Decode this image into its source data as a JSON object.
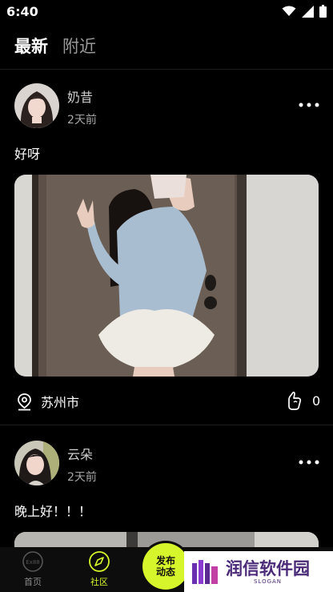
{
  "status_bar": {
    "time": "6:40"
  },
  "tabs": [
    {
      "label": "最新",
      "active": true
    },
    {
      "label": "附近",
      "active": false
    }
  ],
  "posts": [
    {
      "username": "奶昔",
      "time": "2天前",
      "text": "好呀",
      "location": "苏州市",
      "likes": "0"
    },
    {
      "username": "云朵",
      "time": "2天前",
      "text": "晚上好！！！"
    }
  ],
  "bottom_nav": {
    "items": [
      {
        "label": "首页",
        "icon": "home-icon",
        "badge": "Ex88"
      },
      {
        "label": "社区",
        "icon": "compass-icon",
        "active": true
      }
    ],
    "publish": [
      "发布",
      "动态"
    ]
  },
  "watermark": {
    "main": "润信软件园",
    "slogan": "SLOGAN"
  },
  "colors": {
    "accent": "#d6f52a",
    "background": "#000000",
    "watermark_text": "#4a2a78"
  }
}
